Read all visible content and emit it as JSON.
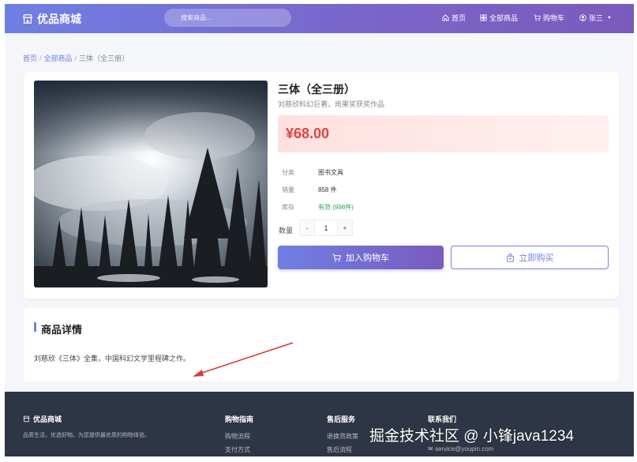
{
  "header": {
    "brand": "优品商城",
    "search_placeholder": "搜索商品...",
    "nav": {
      "home": "首页",
      "all_products": "全部商品",
      "cart": "购物车",
      "user": "张三"
    }
  },
  "breadcrumb": {
    "home": "首页",
    "all": "全部商品",
    "current": "三体（全三册）",
    "separator": "/"
  },
  "product": {
    "title": "三体（全三册）",
    "subtitle": "刘慈欣科幻巨著，雨果奖获奖作品",
    "price": "¥68.00",
    "info": [
      {
        "label": "分类",
        "value": "图书文具"
      },
      {
        "label": "销量",
        "value": "858 件"
      },
      {
        "label": "库存",
        "value": "有货 (998件)"
      }
    ],
    "quantity_label": "数量",
    "quantity": "1",
    "minus": "-",
    "plus": "+",
    "add_to_cart": "加入购物车",
    "buy_now": "立即购买"
  },
  "detail": {
    "title": "商品详情",
    "text": "刘慈欣《三体》全集，中国科幻文学里程碑之作。"
  },
  "footer": {
    "brand": "优品商城",
    "desc": "品质生活，优选好物。为您提供最优质的购物体验。",
    "col1_title": "购物指南",
    "col1_links": [
      "购物流程",
      "支付方式"
    ],
    "col2_title": "售后服务",
    "col2_links": [
      "退换货政策",
      "售后流程"
    ],
    "col3_title": "联系我们",
    "col3_links": [
      "service@youpin.com"
    ]
  },
  "watermark": "掘金技术社区 @ 小锋java1234",
  "colors": {
    "accent": "#6f7fe4",
    "accent2": "#7a5bbd",
    "price": "#e0453f",
    "stock": "#2aa55a",
    "footer_bg": "#2e3544"
  }
}
